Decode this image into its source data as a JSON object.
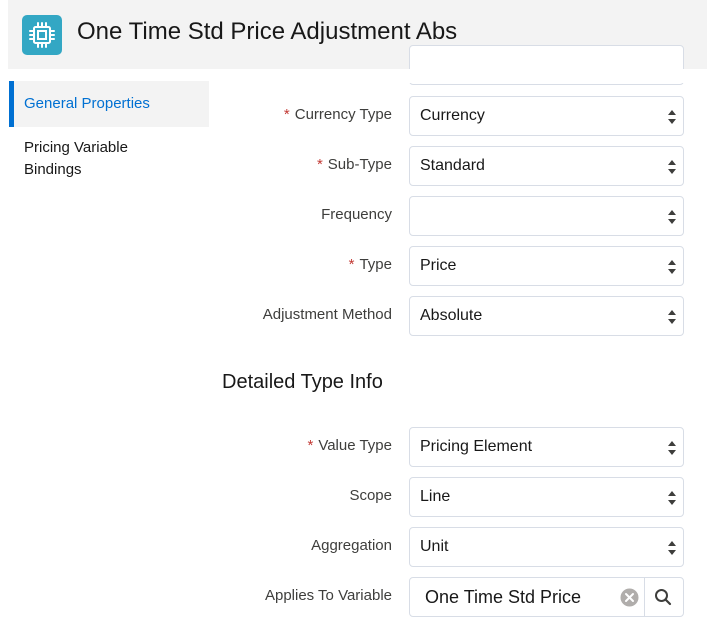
{
  "header": {
    "title": "One Time Std Price Adjustment Abs",
    "icon": "processor-chip-icon",
    "icon_color": "#33a7c4"
  },
  "sidebar": {
    "items": [
      {
        "label": "General Properties",
        "active": true
      },
      {
        "label_lines": [
          "Pricing Variable",
          "Bindings"
        ],
        "active": false
      }
    ]
  },
  "form": {
    "required_marker": "*",
    "fields": [
      {
        "label": "Currency Type",
        "required": true,
        "value": "Currency"
      },
      {
        "label": "Sub-Type",
        "required": true,
        "value": "Standard"
      },
      {
        "label": "Frequency",
        "required": false,
        "value": ""
      },
      {
        "label": "Type",
        "required": true,
        "value": "Price"
      },
      {
        "label": "Adjustment Method",
        "required": false,
        "value": "Absolute"
      }
    ],
    "section_title": "Detailed Type Info",
    "detail_fields": [
      {
        "label": "Value Type",
        "required": true,
        "value": "Pricing Element"
      },
      {
        "label": "Scope",
        "required": false,
        "value": "Line"
      },
      {
        "label": "Aggregation",
        "required": false,
        "value": "Unit"
      }
    ],
    "lookup": {
      "label": "Applies To Variable",
      "value": "One Time Std Price"
    }
  },
  "colors": {
    "accent": "#0070d2",
    "required": "#c23934",
    "header_bg": "#f3f3f3"
  }
}
